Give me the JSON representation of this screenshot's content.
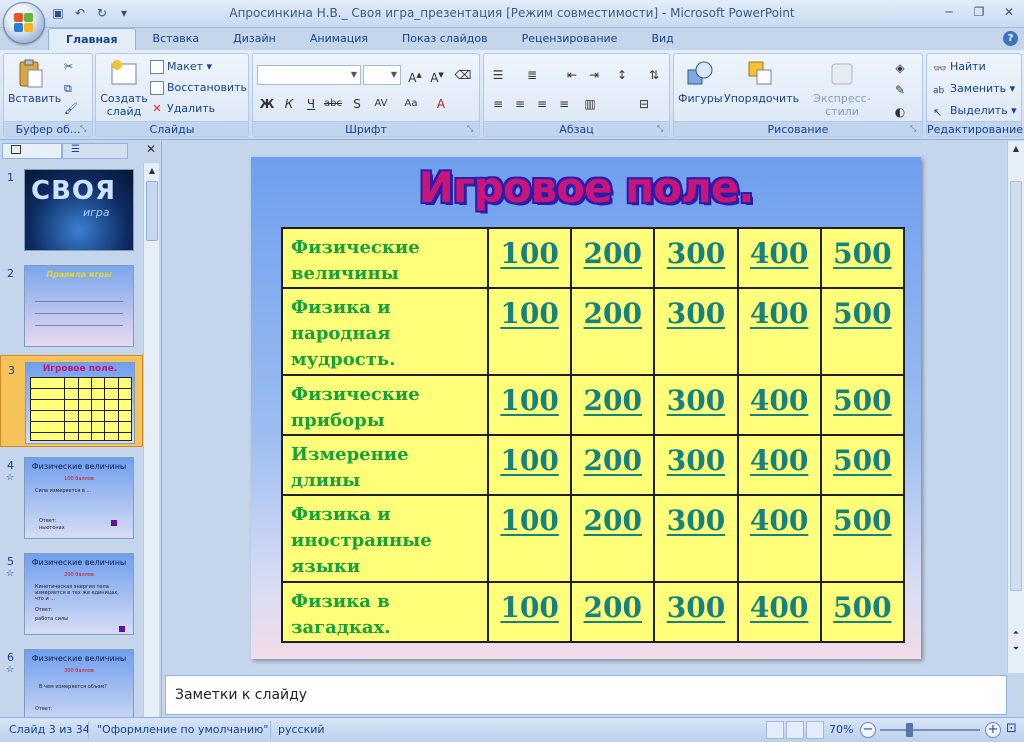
{
  "window": {
    "title": "Апросинкина Н.В._ Своя игра_презентация [Режим совместимости] - Microsoft PowerPoint"
  },
  "ribbon": {
    "tabs": [
      "Главная",
      "Вставка",
      "Дизайн",
      "Анимация",
      "Показ слайдов",
      "Рецензирование",
      "Вид"
    ],
    "active_tab": "Главная",
    "clipboard": {
      "label": "Буфер об...",
      "paste": "Вставить"
    },
    "slides": {
      "label": "Слайды",
      "new_slide": "Создать слайд",
      "layout": "Макет",
      "reset": "Восстановить",
      "delete": "Удалить"
    },
    "font": {
      "label": "Шрифт"
    },
    "paragraph": {
      "label": "Абзац"
    },
    "drawing": {
      "label": "Рисование",
      "shapes": "Фигуры",
      "arrange": "Упорядочить",
      "quick_styles": "Экспресс-стили"
    },
    "editing": {
      "label": "Редактирование",
      "find": "Найти",
      "replace": "Заменить",
      "select": "Выделить"
    }
  },
  "slides_pane": {
    "thumbnails": [
      {
        "num": "1",
        "caption": "СВОЯ",
        "sub": "игра"
      },
      {
        "num": "2",
        "caption": "Правила игры"
      },
      {
        "num": "3",
        "caption": "Игровое поле."
      },
      {
        "num": "4",
        "caption": "Физические величины",
        "points": "100 баллов",
        "q": "Сила измеряется  в ...",
        "answer_label": "Ответ:",
        "answer": "ньютонах"
      },
      {
        "num": "5",
        "caption": "Физические величины",
        "points": "200 баллов",
        "q": "Кинетическая энергия тела измеряется в тех же единицах, что и ...",
        "answer_label": "Ответ:",
        "answer": "работа силы"
      },
      {
        "num": "6",
        "caption": "Физические величины",
        "points": "300 баллов",
        "q": "В чем измеряется объем?",
        "answer_label": "Ответ:"
      }
    ]
  },
  "slide": {
    "title": "Игровое поле.",
    "rows": [
      {
        "category": "Физические величины",
        "values": [
          "100",
          "200",
          "300",
          "400",
          "500"
        ]
      },
      {
        "category": "Физика и народная мудрость.",
        "values": [
          "100",
          "200",
          "300",
          "400",
          "500"
        ]
      },
      {
        "category": "Физические приборы",
        "values": [
          "100",
          "200",
          "300",
          "400",
          "500"
        ]
      },
      {
        "category": "Измерение длины",
        "values": [
          "100",
          "200",
          "300",
          "400",
          "500"
        ]
      },
      {
        "category": "Физика и иностранные языки",
        "values": [
          "100",
          "200",
          "300",
          "400",
          "500"
        ]
      },
      {
        "category": "Физика в загадках.",
        "values": [
          "100",
          "200",
          "300",
          "400",
          "500"
        ]
      }
    ]
  },
  "notes": {
    "placeholder": "Заметки к слайду"
  },
  "status": {
    "slide_counter": "Слайд 3 из 34",
    "theme": "\"Оформление по умолчанию\"",
    "language": "русский",
    "zoom": "70%"
  },
  "colors": {
    "category_text": "#14a33a",
    "value_text": "#16827f",
    "table_bg": "#ffff7a",
    "title_fill": "#c8157a",
    "title_outline": "#2c1da8"
  }
}
